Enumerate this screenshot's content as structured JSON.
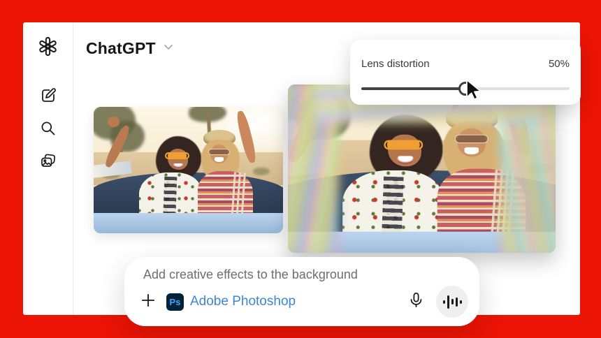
{
  "app": {
    "name": "ChatGPT"
  },
  "header": {
    "title": "ChatGPT"
  },
  "sidebar": {
    "items": [
      {
        "icon": "openai-logo"
      },
      {
        "icon": "new-chat-pencil"
      },
      {
        "icon": "search"
      },
      {
        "icon": "image-library"
      }
    ]
  },
  "lens_panel": {
    "label": "Lens distortion",
    "value": "50%",
    "percent": 50
  },
  "composer": {
    "placeholder": "Add creative effects to the background",
    "tool": {
      "badge": "Ps",
      "name": "Adobe Photoshop"
    },
    "icons": [
      "plus",
      "microphone",
      "voice-waveform"
    ]
  },
  "images": {
    "count": 2,
    "style": "original and lens-distorted variant"
  },
  "colors": {
    "frame_red": "#ec1405",
    "tool_blue": "#3e86d1",
    "badge_bg": "#002338",
    "badge_fg": "#3ba7ff",
    "slider_fill": "#424242",
    "slider_track": "#e0e0e0"
  }
}
